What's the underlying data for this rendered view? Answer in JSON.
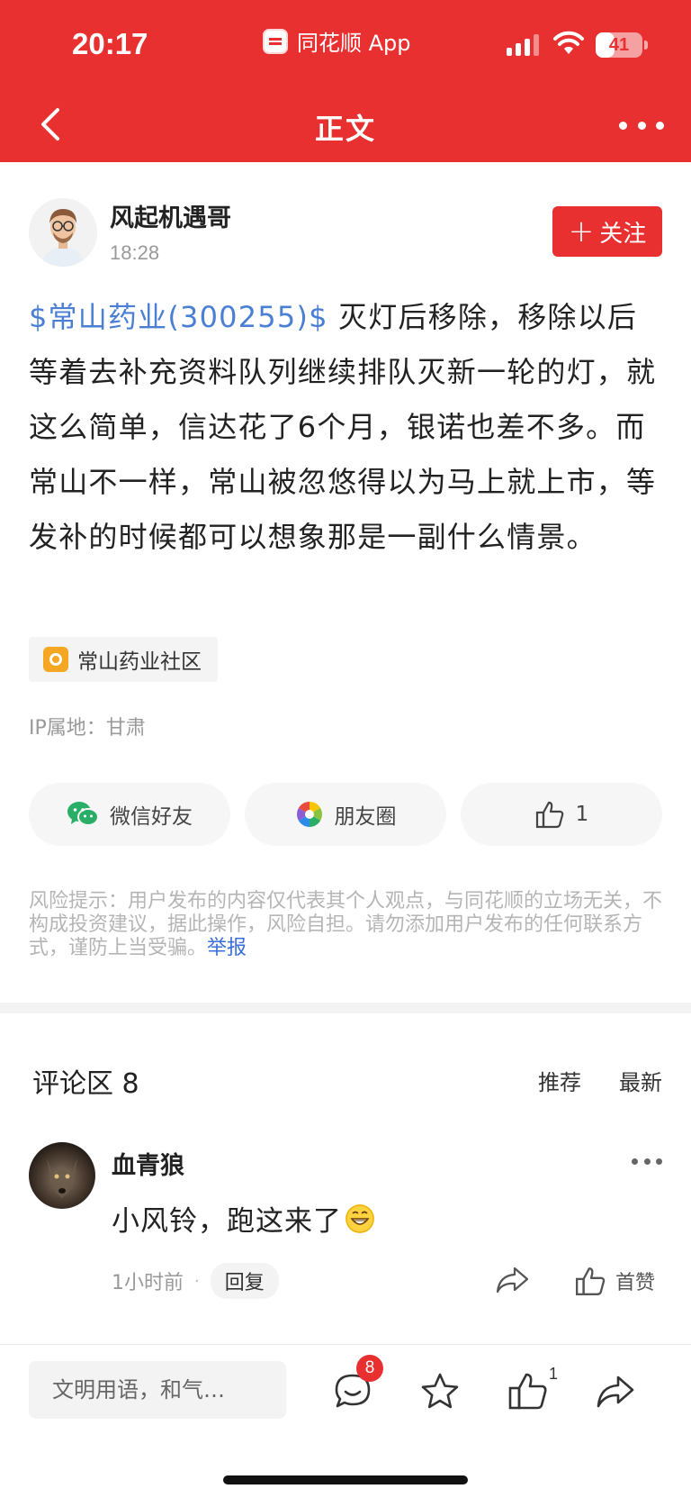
{
  "status_bar": {
    "time": "20:17",
    "app_name": "同花顺 App",
    "battery": "41",
    "battery_level": 0.41
  },
  "nav": {
    "title": "正文"
  },
  "post": {
    "author": "风起机遇哥",
    "time": "18:28",
    "follow_label": "关注",
    "stock_link": "$常山药业(300255)$",
    "text": " 灭灯后移除，移除以后等着去补充资料队列继续排队灭新一轮的灯，就这么简单，信达花了6个月，银诺也差不多。而常山不一样，常山被忽悠得以为马上就上市，等发补的时候都可以想象那是一副什么情景。",
    "community_tag": "常山药业社区",
    "ip_location": "IP属地：甘肃"
  },
  "share": {
    "wechat": "微信好友",
    "moments": "朋友圈",
    "like_count": "1"
  },
  "risk_notice": {
    "text": "风险提示：用户发布的内容仅代表其个人观点，与同花顺的立场无关，不构成投资建议，据此操作，风险自担。请勿添加用户发布的任何联系方式，谨防上当受骗。",
    "report": "举报"
  },
  "comments": {
    "title": "评论区 8",
    "sort_recommend": "推荐",
    "sort_latest": "最新",
    "items": [
      {
        "user": "血青狼",
        "text": "小风铃，跑这来了",
        "emoji": "grinning-face-emoji",
        "time": "1小时前",
        "dot": "·",
        "reply": "回复",
        "like": "首赞"
      }
    ]
  },
  "bottom_bar": {
    "input_placeholder": "文明用语，和气…",
    "comment_badge": "8",
    "like_count": "1"
  },
  "colors": {
    "brand_red": "#e93030",
    "link_blue": "#4a7fd4",
    "report_blue": "#3a6fd8"
  }
}
